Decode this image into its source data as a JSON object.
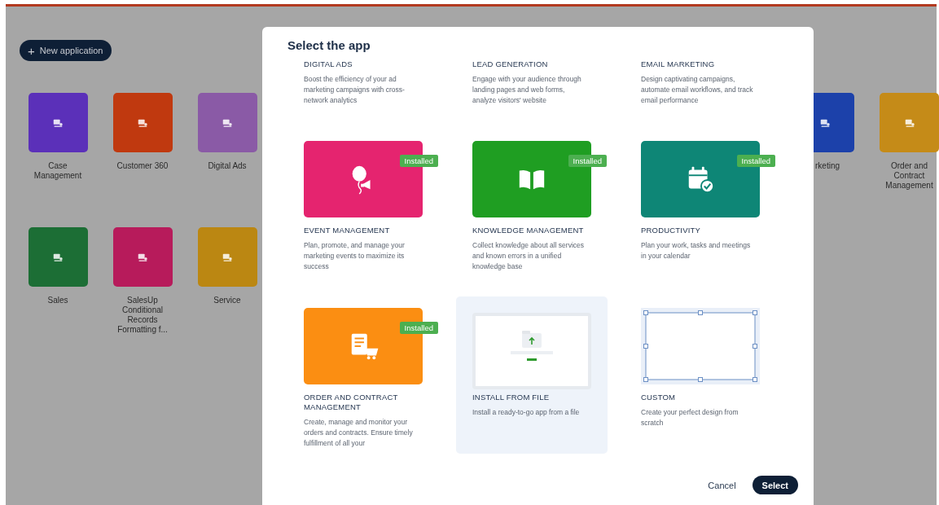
{
  "new_app_button": {
    "icon": "+",
    "label": "New application"
  },
  "app_rows": [
    {
      "left": [
        {
          "label": "Case Management",
          "color": "#5b30b9",
          "kind": "full"
        },
        {
          "label": "Customer 360",
          "color": "#c0390f",
          "kind": "full"
        },
        {
          "label": "Digital Ads",
          "color": "#8a5aa6",
          "kind": "full"
        }
      ],
      "right": [
        {
          "label": "rketing",
          "color": "#1c41aa",
          "kind": "partial"
        },
        {
          "label": "Order and Contract Management",
          "color": "#c58b18",
          "kind": "full"
        }
      ]
    },
    {
      "left": [
        {
          "label": "Sales",
          "color": "#1c6e35",
          "kind": "full"
        },
        {
          "label": "SalesUp Conditional Records Formatting f...",
          "color": "#b71b5b",
          "kind": "full"
        },
        {
          "label": "Service",
          "color": "#bb8712",
          "kind": "full"
        }
      ],
      "right": []
    }
  ],
  "dialog": {
    "title": "Select the app",
    "items": [
      {
        "kind": "text",
        "title": "DIGITAL ADS",
        "description": "Boost the efficiency of your ad marketing campaigns with cross-network analytics",
        "selected": false
      },
      {
        "kind": "text",
        "title": "LEAD GENERATION",
        "description": "Engage with your audience through landing pages and web forms, analyze visitors' website",
        "selected": false
      },
      {
        "kind": "text",
        "title": "EMAIL MARKETING",
        "description": "Design captivating campaigns, automate email workflows, and track email performance",
        "selected": false
      },
      {
        "kind": "app",
        "title": "EVENT MANAGEMENT",
        "description": "Plan, promote, and manage your marketing events to maximize its success",
        "selected": false,
        "installed": true,
        "badge": "Installed",
        "color": "#e5246f"
      },
      {
        "kind": "app",
        "title": "KNOWLEDGE MANAGEMENT",
        "description": "Collect knowledge about all services and known errors in a unified knowledge base",
        "selected": false,
        "installed": true,
        "badge": "Installed",
        "color": "#1f9e22"
      },
      {
        "kind": "app",
        "title": "PRODUCTIVITY",
        "description": "Plan your work, tasks and meetings in your calendar",
        "selected": false,
        "installed": true,
        "badge": "Installed",
        "color": "#0e8676"
      },
      {
        "kind": "app",
        "title": "ORDER AND CONTRACT MANAGEMENT",
        "description": "Create, manage and monitor your orders and contracts. Ensure timely fulfillment of all your",
        "selected": false,
        "installed": true,
        "badge": "Installed",
        "color": "#fb8e12"
      },
      {
        "kind": "file",
        "title": "INSTALL FROM FILE",
        "description": "Install a ready-to-go app from a file",
        "selected": true
      },
      {
        "kind": "custom",
        "title": "CUSTOM",
        "description": "Create your perfect design from scratch",
        "selected": false
      }
    ],
    "buttons": [
      {
        "label": "Cancel",
        "kind": "text"
      },
      {
        "label": "Select",
        "kind": "primary"
      }
    ]
  }
}
